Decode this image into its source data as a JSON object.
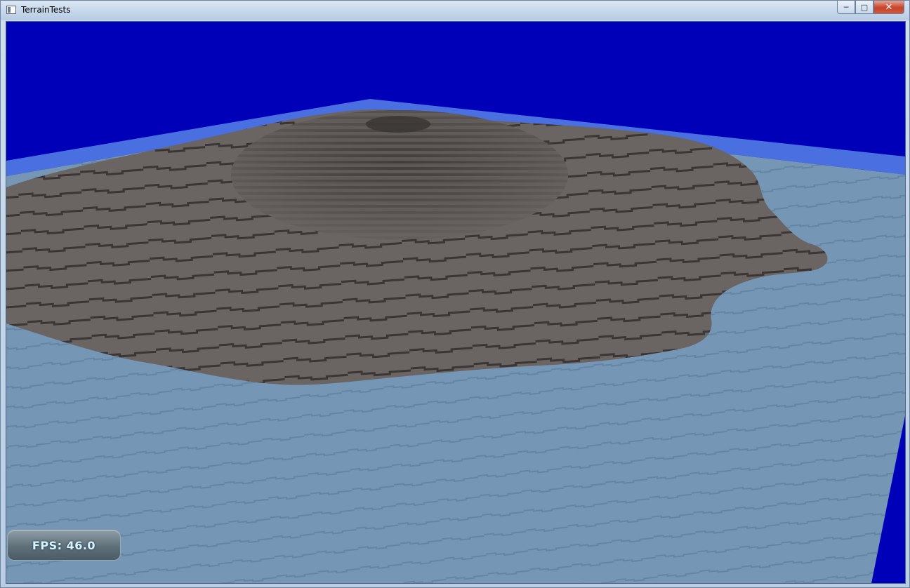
{
  "window": {
    "title": "TerrainTests",
    "buttons": {
      "minimize_icon": "minimize-icon",
      "maximize_icon": "maximize-icon",
      "close_icon": "close-icon"
    }
  },
  "scene": {
    "sky_color": "#0000b8",
    "water_edge_color": "#4a6fe0",
    "water_color": "#7596b4",
    "terrain_color": "#6a6462",
    "terrain_step_color": "#3a3634"
  },
  "hud": {
    "fps_label": "FPS:",
    "fps_value": "46.0"
  }
}
